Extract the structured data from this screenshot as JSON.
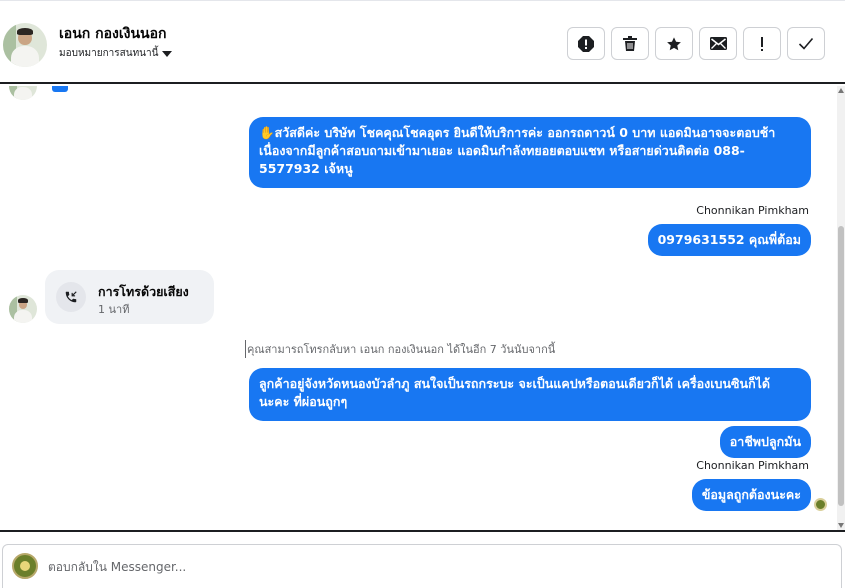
{
  "header": {
    "contact_name": "เอนก กองเงินนอก",
    "assign_label": "มอบหมายการสนทนานี้",
    "actions": [
      {
        "name": "report-icon",
        "glyph": "!"
      },
      {
        "name": "trash-icon",
        "glyph": "🗑"
      },
      {
        "name": "star-icon",
        "glyph": "★"
      },
      {
        "name": "mail-icon",
        "glyph": "✉"
      },
      {
        "name": "mark-important-icon",
        "glyph": "!"
      },
      {
        "name": "check-icon",
        "glyph": "✓"
      }
    ]
  },
  "thread": {
    "messages": [
      {
        "text": "✋สวัสดีค่ะ บริษัท โชคคุณโชคอุดร ยินดีให้บริการค่ะ ออกรถดาวน์ 0 บาท แอดมินอาจจะตอบช้าเนื่องจากมีลูกค้าสอบถามเข้ามาเยอะ แอดมินกำลังทยอยตอบแชท หรือสายด่วนติดต่อ 088-5577932 เจ้หนู"
      },
      {
        "sender": "Chonnikan Pimkham",
        "text": "0979631552 คุณพี่ต้อม"
      },
      {
        "text": "ลูกค้าอยู่จังหวัดหนองบัวลำภู สนใจเป็นรถกระบะ จะเป็นแคปหรือตอนเดียวก็ได้ เครื่องเบนซินก็ได้ นะคะ ที่ผ่อนถูกๆ"
      },
      {
        "text": "อาชีพปลูกมัน"
      },
      {
        "sender": "Chonnikan Pimkham",
        "text": "ข้อมูลถูกต้องนะคะ"
      }
    ],
    "call": {
      "title": "การโทรด้วยเสียง",
      "duration": "1 นาที"
    },
    "notice": "คุณสามารถโทรกลับหา เอนก กองเงินนอก ได้ในอีก 7 วันนับจากนี้"
  },
  "composer": {
    "placeholder": "ตอบกลับใน Messenger..."
  },
  "colors": {
    "accent": "#1877f2",
    "call_bg": "#f0f2f5"
  }
}
